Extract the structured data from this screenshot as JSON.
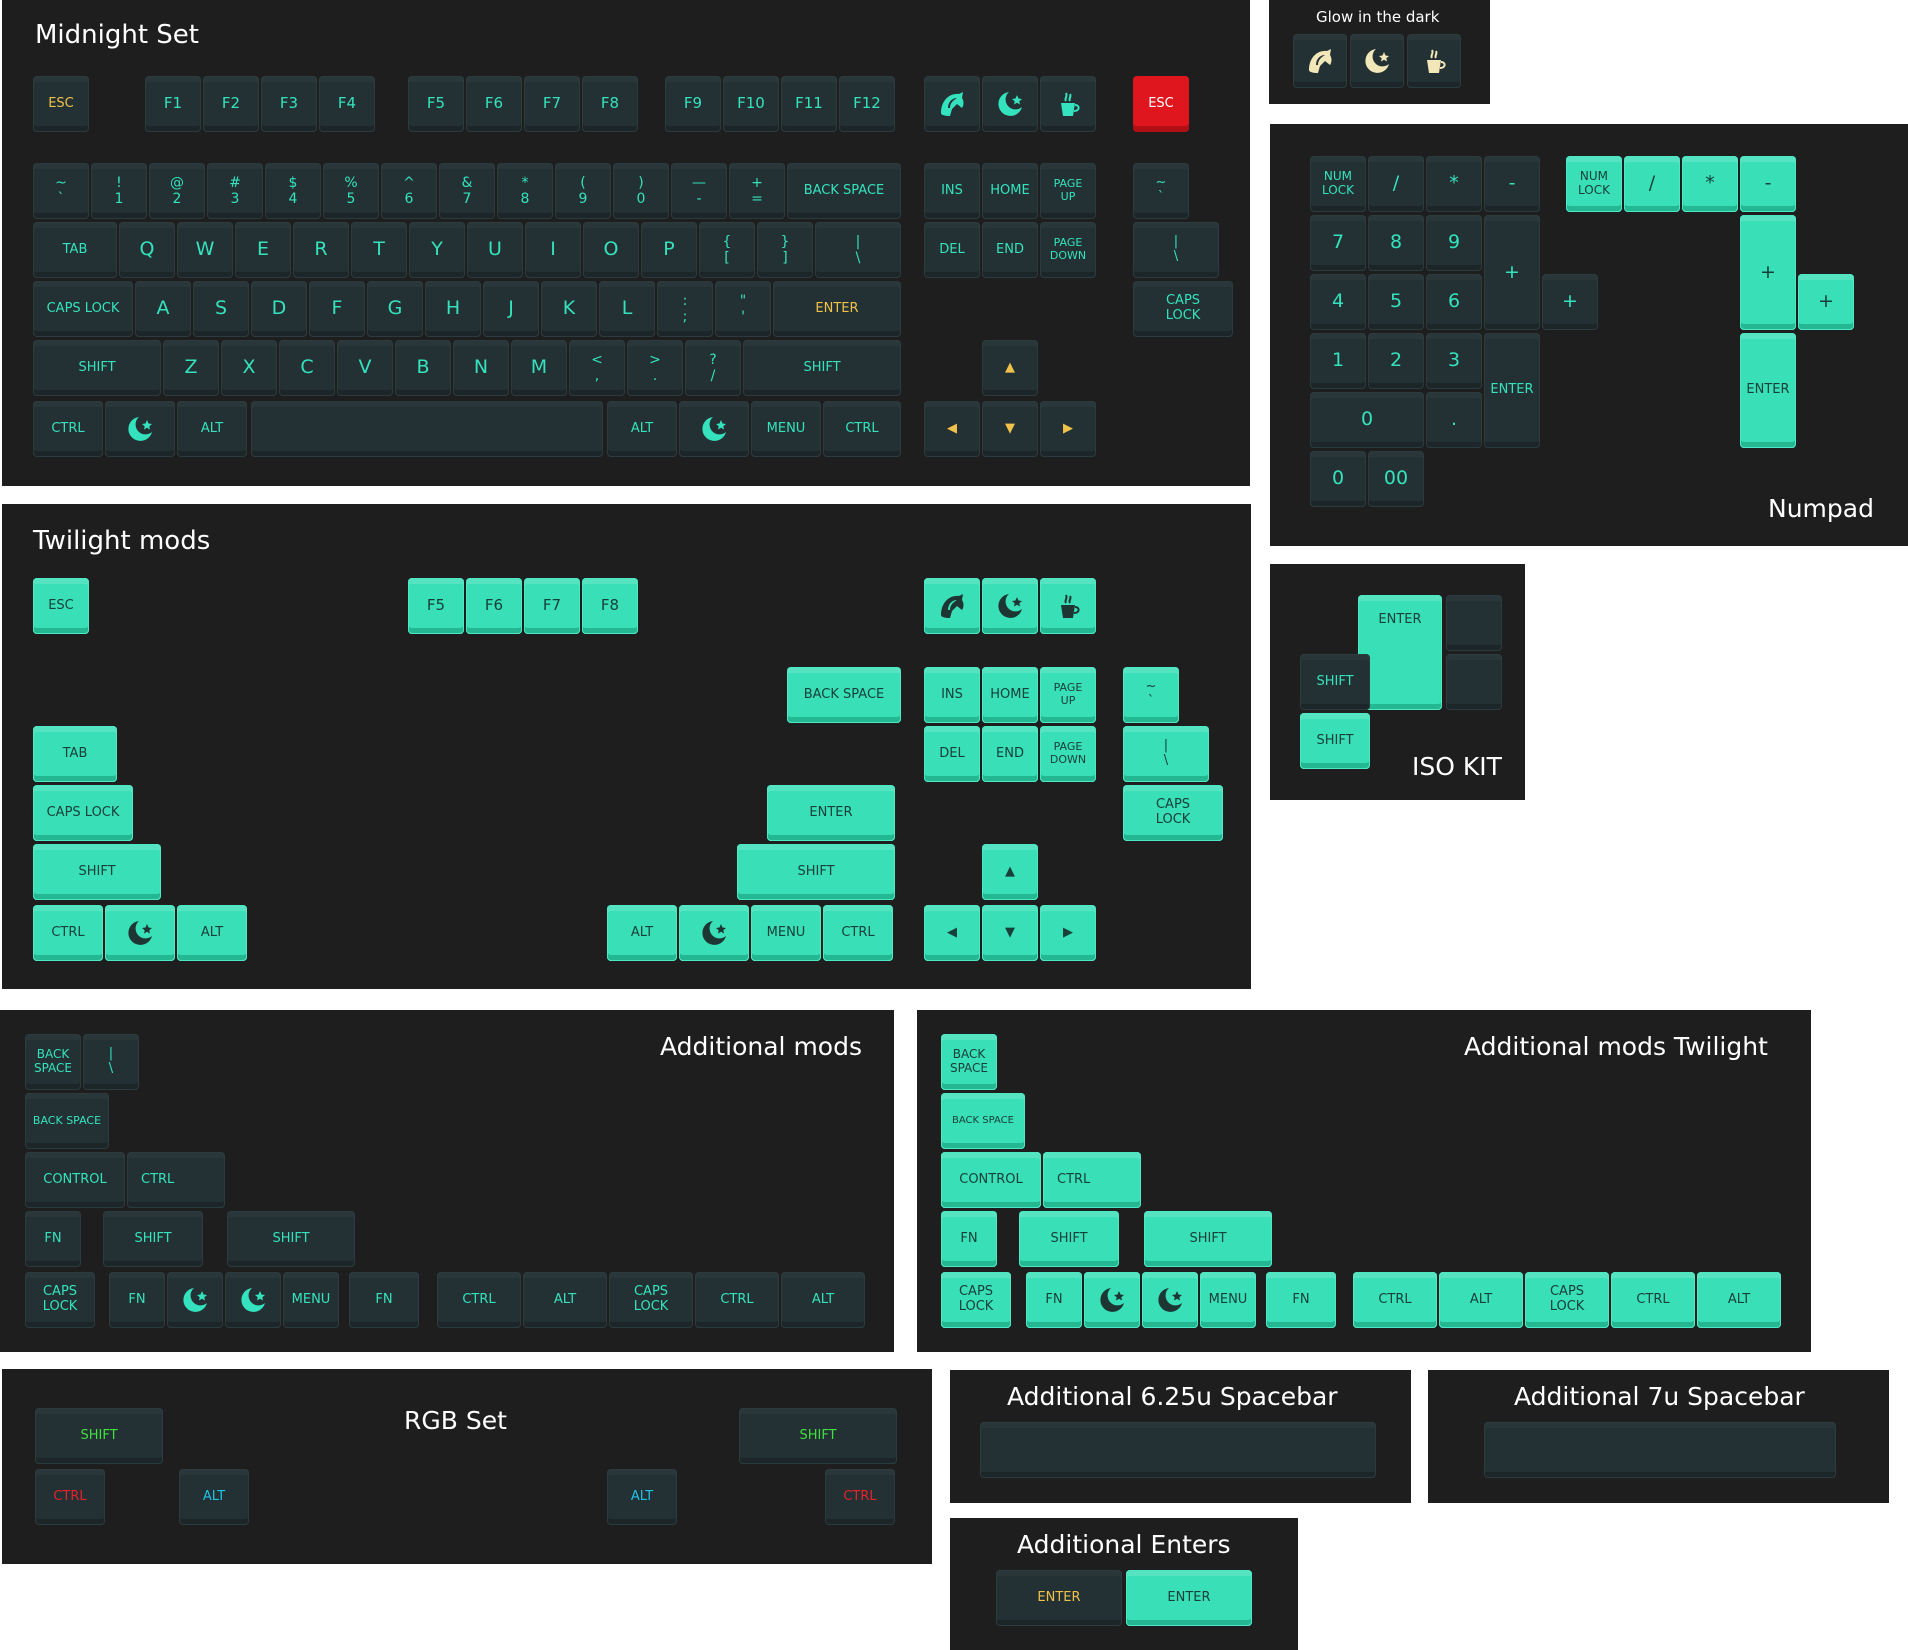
{
  "colors": {
    "panel_bg": "#1e1e1f",
    "key_dark": "#243134",
    "key_teal": "#38dfb7",
    "legend_teal": "#34e3bd",
    "legend_dark": "#17403a",
    "accent_yellow": "#f0c24a",
    "accent_red": "#e0161f",
    "glow": "#f2e7b9",
    "rgb_green": "#3fe040",
    "rgb_red": "#e8222a",
    "rgb_blue": "#1ec3e8"
  },
  "titles": {
    "midnight": "Midnight Set",
    "glow": "Glow in the dark",
    "numpad": "Numpad",
    "twilight": "Twilight mods",
    "iso": "ISO KIT",
    "addmods": "Additional mods",
    "addmods_tw": "Additional mods Twilight",
    "rgb": "RGB Set",
    "space625": "Additional 6.25u Spacebar",
    "space7": "Additional 7u Spacebar",
    "enters": "Additional Enters"
  },
  "icons": {
    "wolf": "wolf-head-icon",
    "moon": "crescent-moon-star-icon",
    "cup": "coffee-cup-icon"
  },
  "keys": {
    "esc": "ESC",
    "f": [
      "F1",
      "F2",
      "F3",
      "F4",
      "F5",
      "F6",
      "F7",
      "F8",
      "F9",
      "F10",
      "F11",
      "F12"
    ],
    "num_row": [
      "~\n`",
      "!\n1",
      "@\n2",
      "#\n3",
      "$\n4",
      "%\n5",
      "^\n6",
      "&\n7",
      "*\n8",
      "(\n9",
      ")\n0",
      "—\n-",
      "+\n="
    ],
    "backspace": "BACK SPACE",
    "tab": "TAB",
    "qrow": [
      "Q",
      "W",
      "E",
      "R",
      "T",
      "Y",
      "U",
      "I",
      "O",
      "P",
      "{\n[",
      "}\n]",
      "|\n\\"
    ],
    "capslock": "CAPS LOCK",
    "caps_stacked": "CAPS\nLOCK",
    "arow": [
      "A",
      "S",
      "D",
      "F",
      "G",
      "H",
      "J",
      "K",
      "L",
      ":\n;",
      "\"\n'"
    ],
    "enter": "ENTER",
    "shift": "SHIFT",
    "zrow": [
      "Z",
      "X",
      "C",
      "V",
      "B",
      "N",
      "M",
      "<\n,",
      ">\n.",
      "?\n/"
    ],
    "ctrl": "CTRL",
    "alt": "ALT",
    "menu": "MENU",
    "ins": "INS",
    "home": "HOME",
    "pageup": "PAGE\nUP",
    "del": "DEL",
    "end": "END",
    "pagedown": "PAGE\nDOWN",
    "tilde": "~\n`",
    "pipe": "|\n\\",
    "up": "▲",
    "down": "▼",
    "left": "◀",
    "right": "▶",
    "numlock": "NUM\nLOCK",
    "slash": "/",
    "star": "*",
    "minus": "-",
    "plus": "+",
    "n7": "7",
    "n8": "8",
    "n9": "9",
    "n4": "4",
    "n5": "5",
    "n6": "6",
    "n1": "1",
    "n2": "2",
    "n3": "3",
    "n0": "0",
    "dot": ".",
    "n00": "00",
    "backspace_stacked": "BACK\nSPACE",
    "control": "CONTROL",
    "fn": "FN"
  }
}
